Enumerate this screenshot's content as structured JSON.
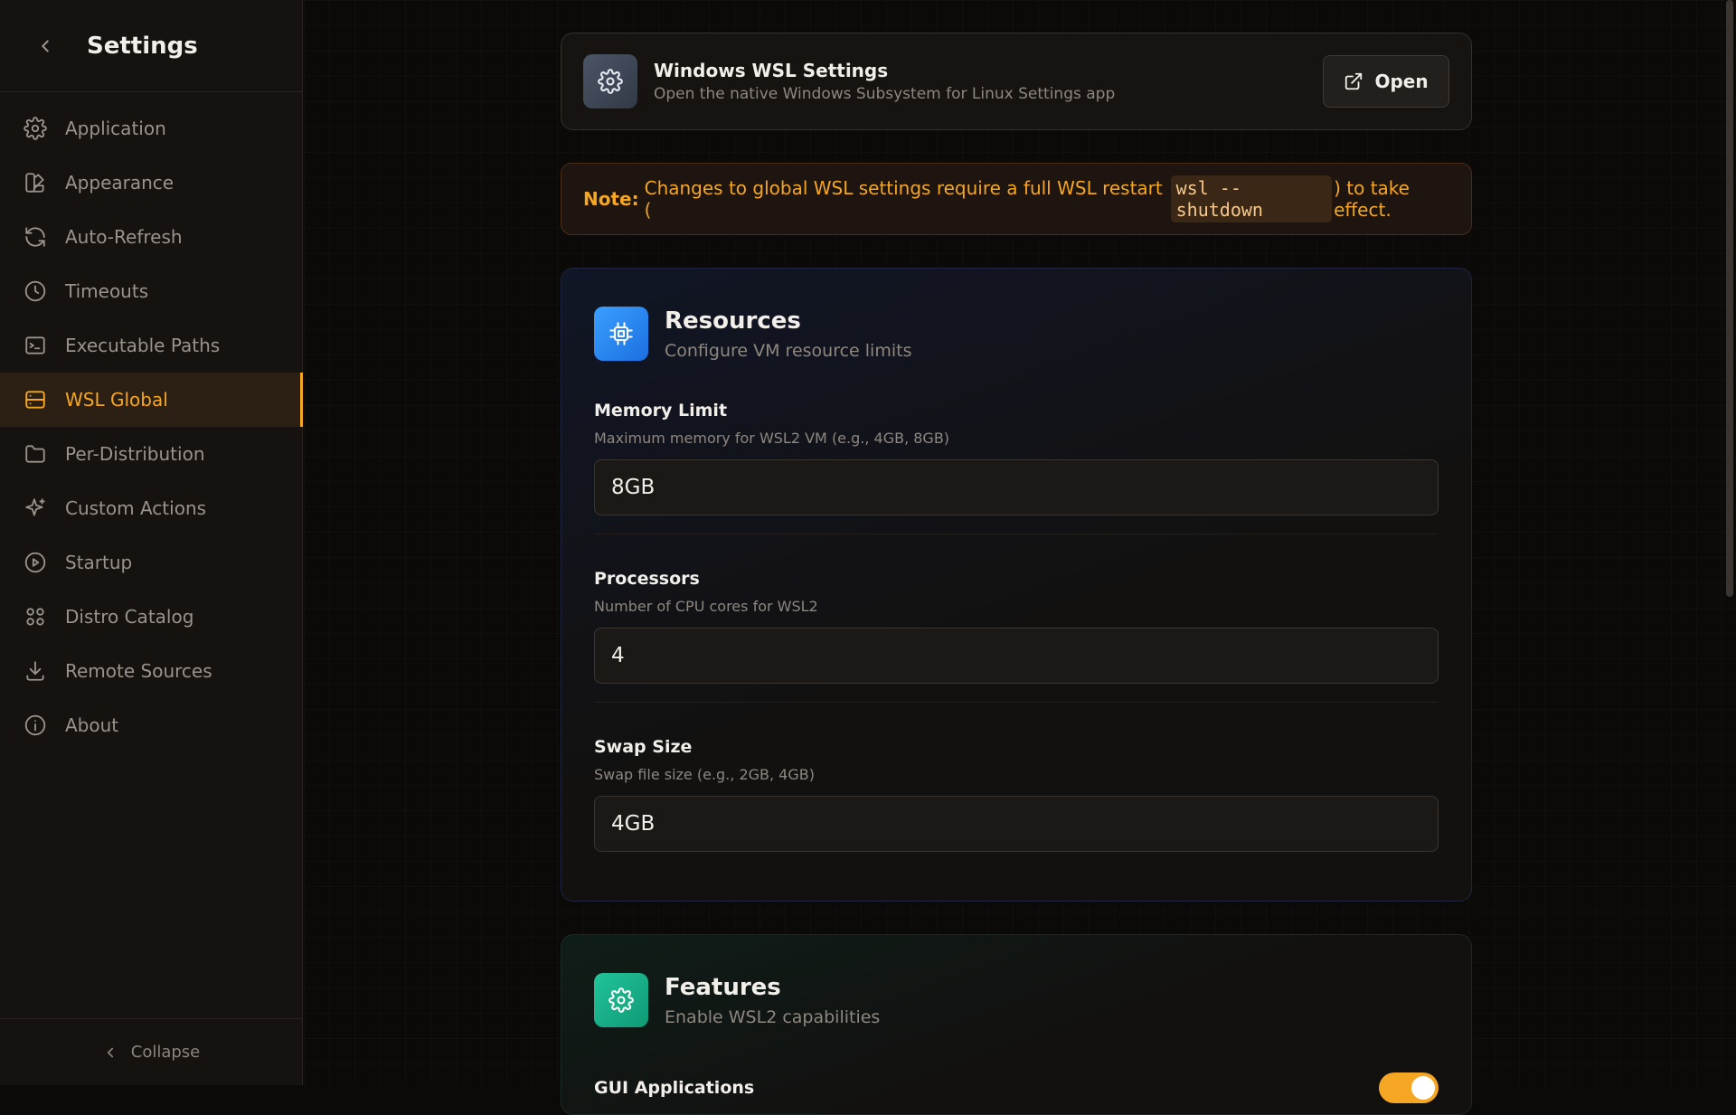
{
  "sidebar": {
    "title": "Settings",
    "items": [
      {
        "label": "Application",
        "icon": "gear-icon"
      },
      {
        "label": "Appearance",
        "icon": "palette-icon"
      },
      {
        "label": "Auto-Refresh",
        "icon": "refresh-icon"
      },
      {
        "label": "Timeouts",
        "icon": "clock-icon"
      },
      {
        "label": "Executable Paths",
        "icon": "terminal-icon"
      },
      {
        "label": "WSL Global",
        "icon": "server-icon",
        "active": true
      },
      {
        "label": "Per-Distribution",
        "icon": "folder-icon"
      },
      {
        "label": "Custom Actions",
        "icon": "sparkle-icon"
      },
      {
        "label": "Startup",
        "icon": "play-circle-icon"
      },
      {
        "label": "Distro Catalog",
        "icon": "grid-icon"
      },
      {
        "label": "Remote Sources",
        "icon": "download-icon"
      },
      {
        "label": "About",
        "icon": "info-icon"
      }
    ],
    "collapse_label": "Collapse"
  },
  "open_card": {
    "title": "Windows WSL Settings",
    "subtitle": "Open the native Windows Subsystem for Linux Settings app",
    "button_label": "Open"
  },
  "note": {
    "prefix": "Note:",
    "text_before": "Changes to global WSL settings require a full WSL restart (",
    "code": "wsl --shutdown",
    "text_after": ") to take effect."
  },
  "resources": {
    "title": "Resources",
    "subtitle": "Configure VM resource limits",
    "fields": [
      {
        "label": "Memory Limit",
        "help": "Maximum memory for WSL2 VM (e.g., 4GB, 8GB)",
        "value": "8GB"
      },
      {
        "label": "Processors",
        "help": "Number of CPU cores for WSL2",
        "value": "4"
      },
      {
        "label": "Swap Size",
        "help": "Swap file size (e.g., 2GB, 4GB)",
        "value": "4GB"
      }
    ]
  },
  "features": {
    "title": "Features",
    "subtitle": "Enable WSL2 capabilities",
    "gui_label": "GUI Applications",
    "gui_enabled": true
  },
  "colors": {
    "accent": "#f5a623",
    "resources_icon": "#1b6fe0",
    "features_icon": "#0f9a75"
  }
}
